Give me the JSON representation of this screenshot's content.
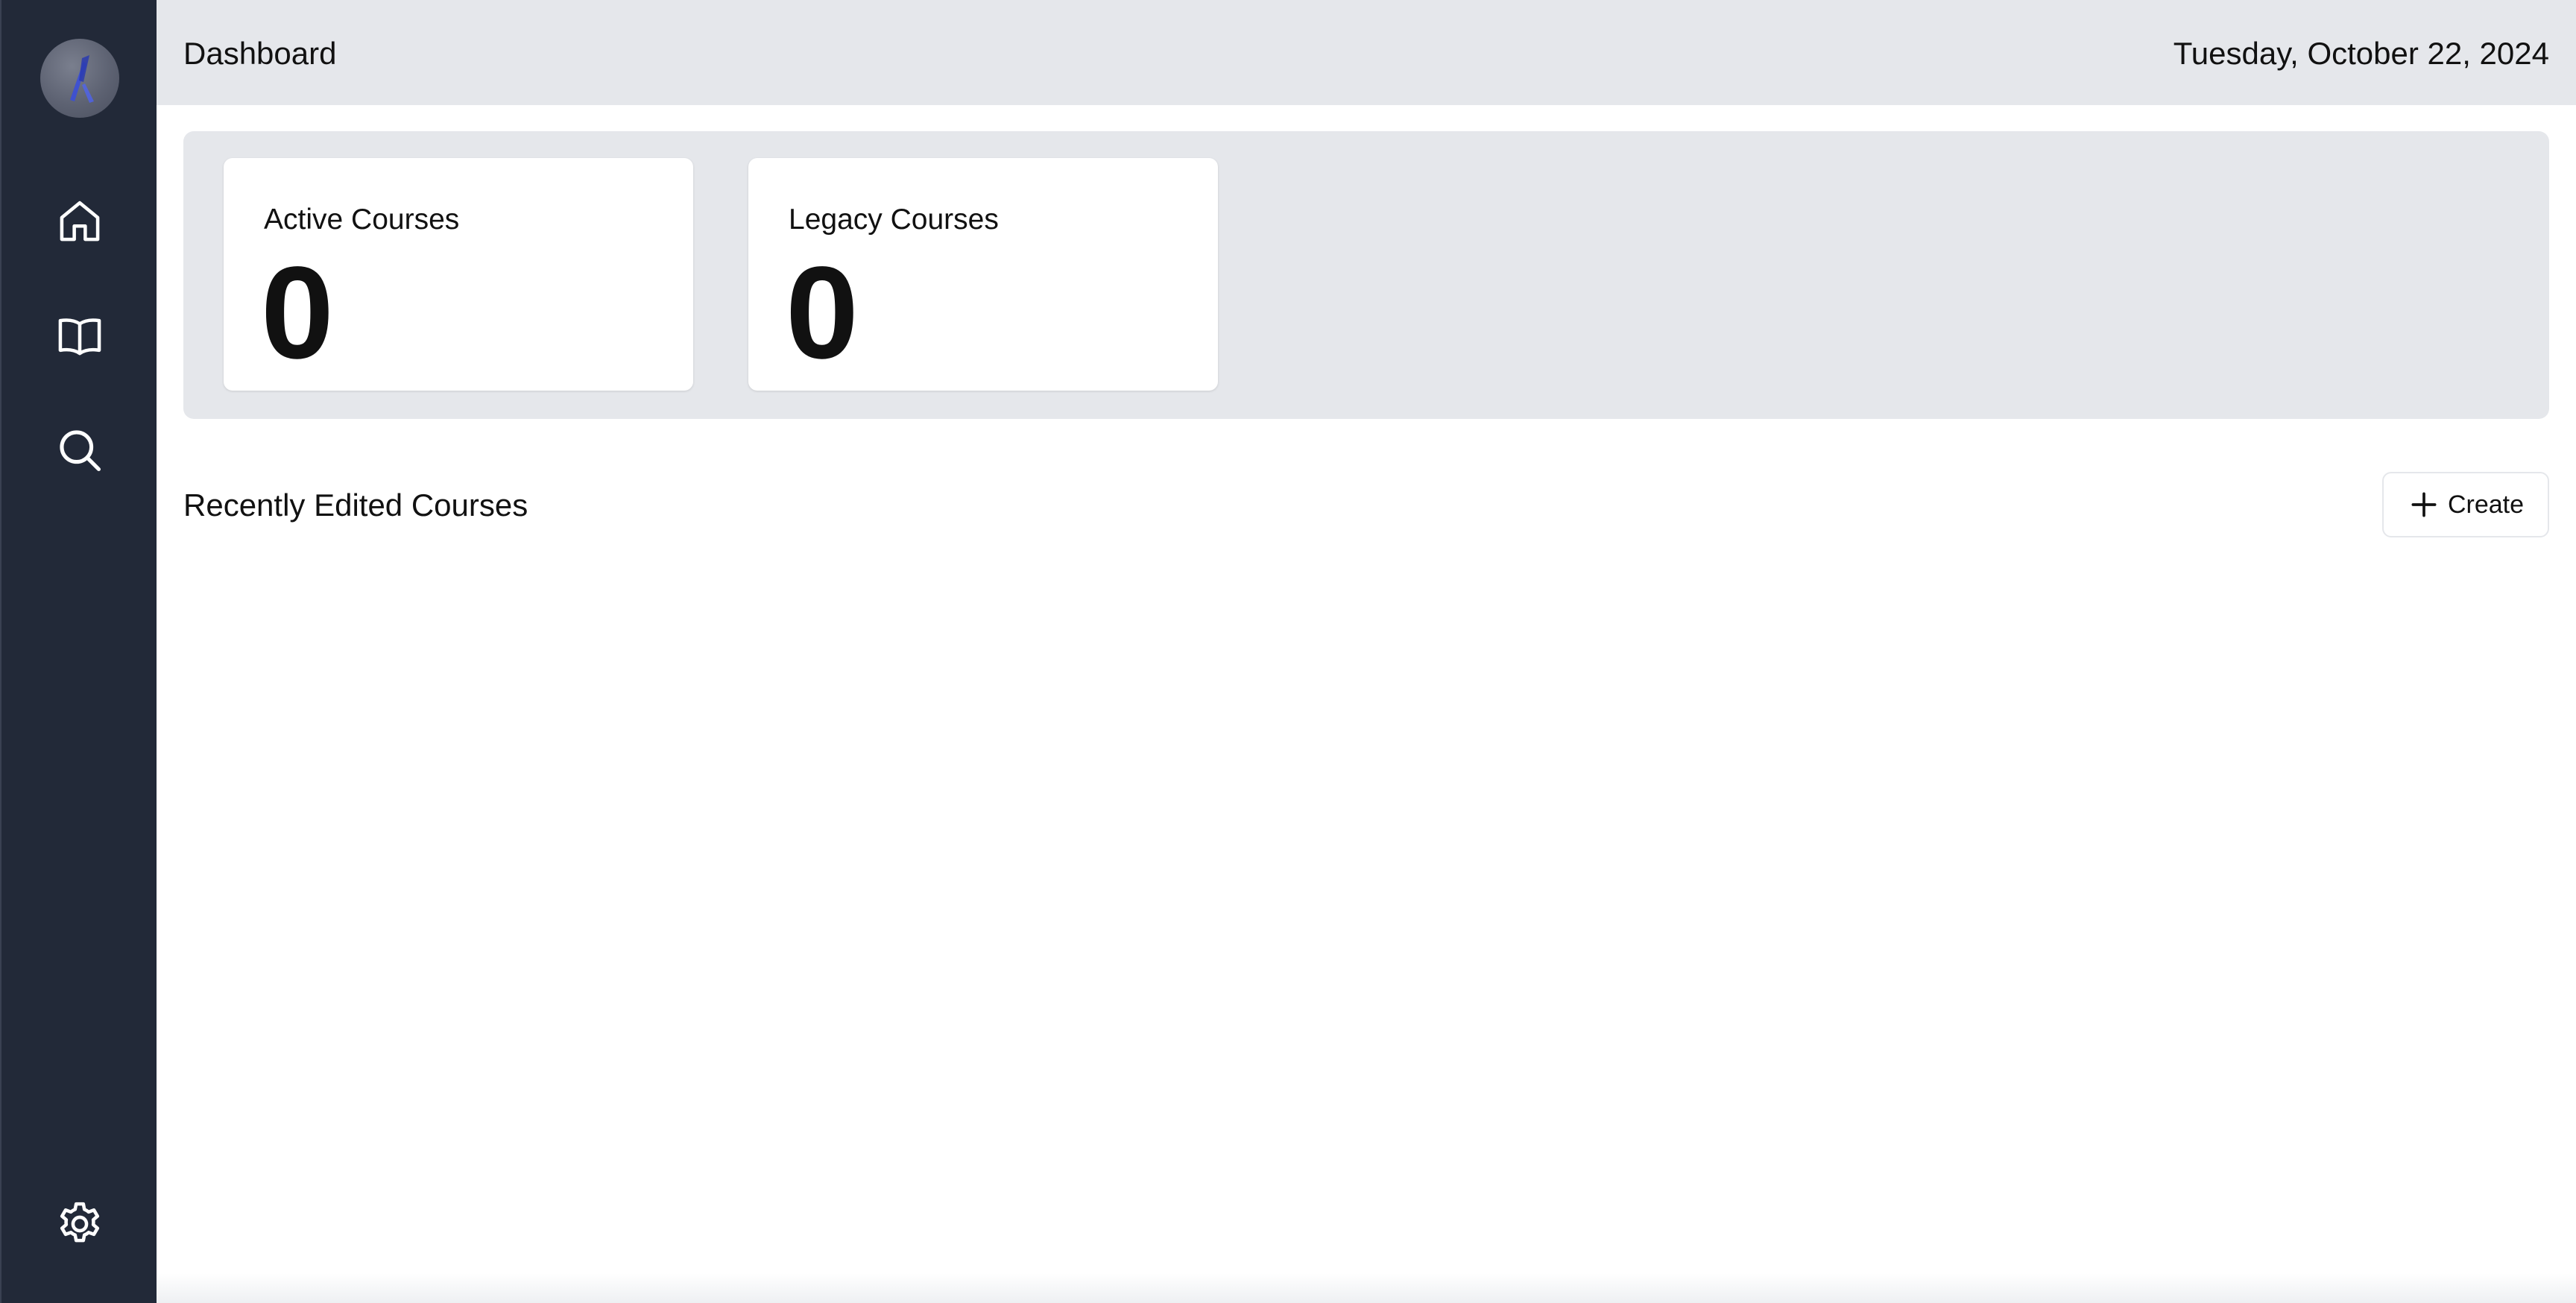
{
  "header": {
    "title": "Dashboard",
    "date": "Tuesday, October 22, 2024"
  },
  "sidebar": {
    "items": [
      {
        "icon": "home-icon",
        "label": "Home"
      },
      {
        "icon": "book-open-icon",
        "label": "Courses"
      },
      {
        "icon": "search-icon",
        "label": "Search"
      },
      {
        "icon": "gear-icon",
        "label": "Settings"
      }
    ]
  },
  "stats": {
    "active": {
      "label": "Active Courses",
      "value": "0"
    },
    "legacy": {
      "label": "Legacy Courses",
      "value": "0"
    }
  },
  "recent": {
    "title": "Recently Edited Courses",
    "create_label": "Create"
  },
  "colors": {
    "sidebar_bg": "#222938",
    "panel_bg": "#e5e7eb",
    "card_bg": "#ffffff",
    "text": "#111111"
  }
}
